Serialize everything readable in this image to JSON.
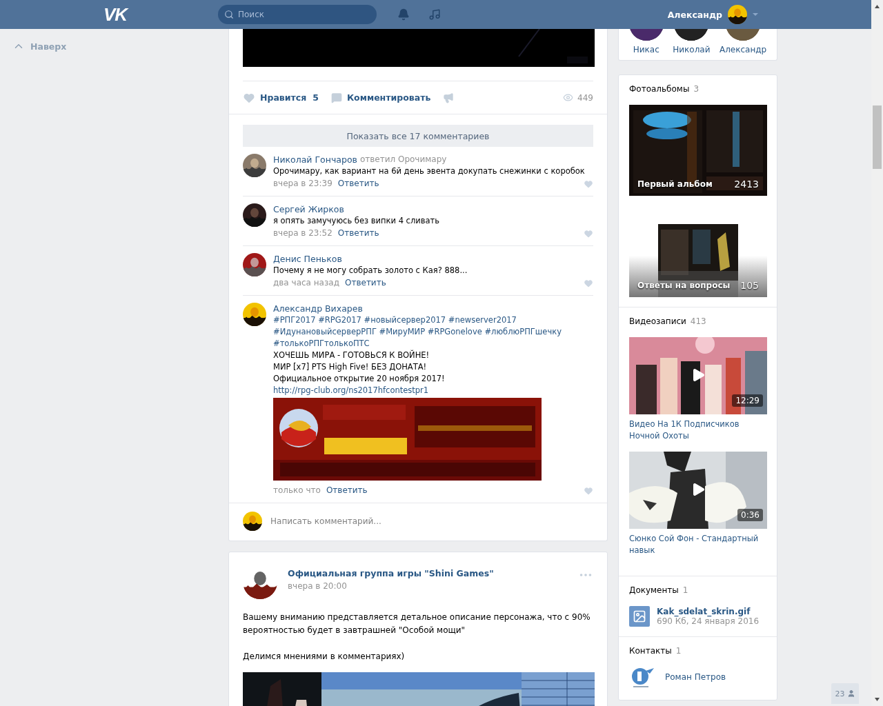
{
  "header": {
    "logo": "VK",
    "search_placeholder": "Поиск",
    "user_name": "Александр"
  },
  "left": {
    "back_to_top": "Наверх"
  },
  "post": {
    "like_label": "Нравится",
    "like_count": "5",
    "liked": false,
    "comment_label": "Комментировать",
    "views": "449",
    "show_all": "Показать все 17 комментариев",
    "comments": [
      {
        "author": "Николай Гончаров",
        "reply_to": "ответил Орочимару",
        "lines": [
          {
            "kind": "text",
            "text": "Орочимару, как вариант на 6й день эвента докупать снежинки с коробок"
          }
        ],
        "time": "вчера в 23:39",
        "reply": "Ответить",
        "liked": false
      },
      {
        "author": "Сергей Жирков",
        "lines": [
          {
            "kind": "text",
            "text": "я опять замучуюсь без випки 4 сливать"
          }
        ],
        "time": "вчера в 23:52",
        "reply": "Ответить",
        "liked": false
      },
      {
        "author": "Денис Пеньков",
        "lines": [
          {
            "kind": "text",
            "text": "Почему я не могу собрать золото с Кая? 888..."
          }
        ],
        "time": "два часа назад",
        "reply": "Ответить",
        "liked": false
      },
      {
        "author": "Александр Вихарев",
        "lines": [
          {
            "kind": "link",
            "text": "#РПГ2017 #RPG2017 #новыйсервер2017 #newserver2017"
          },
          {
            "kind": "link",
            "text": "#ИдунановыйсерверРПГ #МируМИР #RPGonelove #люблюРПГшечку"
          },
          {
            "kind": "link",
            "text": "#толькоРПГтолькоПТС"
          },
          {
            "kind": "text",
            "text": "ХОЧЕШЬ МИРА - ГОТОВЬСЯ К ВОЙНЕ!"
          },
          {
            "kind": "text",
            "text": "МИР [x7] PTS High Five! БЕЗ ДОНАТА!"
          },
          {
            "kind": "text",
            "text": "Официальное открытие 20 ноября 2017!"
          },
          {
            "kind": "link",
            "text": "http://rpg-club.org/ns2017hfcontestpr1"
          }
        ],
        "attachment": {
          "kind": "picture"
        },
        "time": "только что",
        "reply": "Ответить",
        "liked": false
      }
    ],
    "comment_placeholder": "Написать комментарий..."
  },
  "post2": {
    "author": "Официальная группа игры \"Shini Games\"",
    "time": "вчера в 20:00",
    "paragraphs": [
      "Вашему вниманию представляется детальное описание персонажа, что с 90% вероятностью будет в завтрашней \"Особой мощи\"",
      "Делимся мнениями в комментариях)"
    ],
    "attachment": {
      "kind": "picture"
    }
  },
  "sidebar": {
    "friends": [
      "Никас",
      "Николай",
      "Александр"
    ],
    "albums": {
      "title": "Фотоальбомы",
      "count": "3",
      "items": [
        {
          "name": "Первый альбом",
          "count": "2413"
        },
        {
          "name": "Ответы на вопросы",
          "count": "105"
        }
      ]
    },
    "videos": {
      "title": "Видеозаписи",
      "count": "413",
      "items": [
        {
          "title": "Видео На 1К Подписчиков Ночной Охоты",
          "duration": "12:29"
        },
        {
          "title": "Сюнко Сой Фон - Стандартный навык",
          "duration": "0:36"
        }
      ]
    },
    "documents": {
      "title": "Документы",
      "count": "1",
      "items": [
        {
          "name": "Kak_sdelat_skrin.gif",
          "meta": "690 Кб, 24 января 2016"
        }
      ]
    },
    "contacts": {
      "title": "Контакты",
      "count": "1",
      "items": [
        {
          "name": "Роман Петров"
        }
      ]
    }
  },
  "online_count": "23"
}
